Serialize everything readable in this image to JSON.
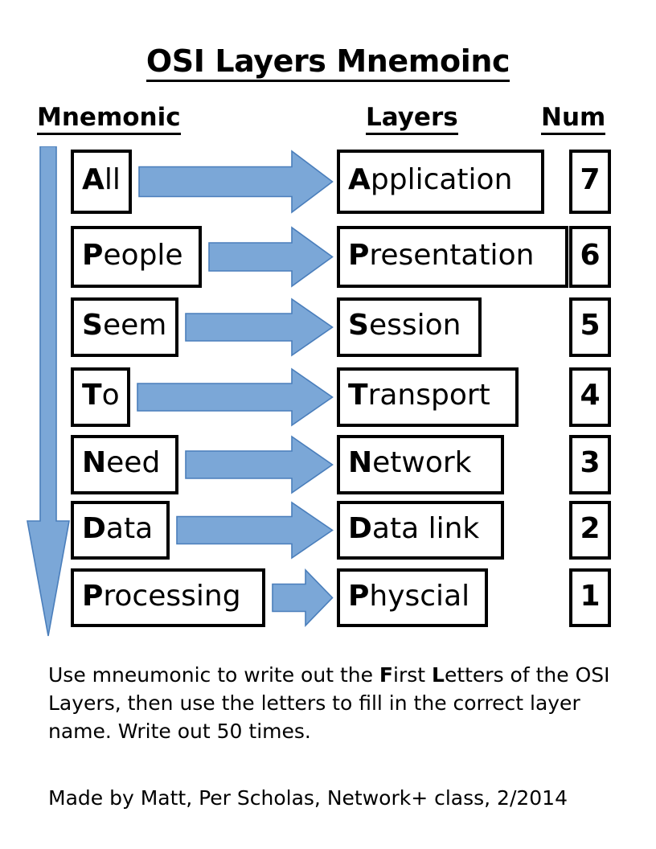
{
  "title": "OSI Layers Mnemoinc",
  "headers": {
    "mnemonic": "Mnemonic",
    "layers": "Layers",
    "num": "Num"
  },
  "colors": {
    "arrow_fill": "#7BA7D7",
    "arrow_stroke": "#4A7EBB",
    "box_border": "#000000",
    "text": "#000000",
    "background": "#FFFFFF"
  },
  "icons": {
    "down_arrow": "down-arrow-icon",
    "right_arrow": "right-arrow-icon"
  },
  "rows": [
    {
      "mnemonic_initial": "A",
      "mnemonic_rest": "ll",
      "mnemonic": "All",
      "layer_initial": "A",
      "layer_rest": "pplication",
      "layer": "Application",
      "num": "7"
    },
    {
      "mnemonic_initial": "P",
      "mnemonic_rest": "eople",
      "mnemonic": "People",
      "layer_initial": "P",
      "layer_rest": "resentation",
      "layer": "Presentation",
      "num": "6"
    },
    {
      "mnemonic_initial": "S",
      "mnemonic_rest": "eem",
      "mnemonic": "Seem",
      "layer_initial": "S",
      "layer_rest": "ession",
      "layer": "Session",
      "num": "5"
    },
    {
      "mnemonic_initial": "T",
      "mnemonic_rest": "o",
      "mnemonic": "To",
      "layer_initial": "T",
      "layer_rest": "ransport",
      "layer": "Transport",
      "num": "4"
    },
    {
      "mnemonic_initial": "N",
      "mnemonic_rest": "eed",
      "mnemonic": "Need",
      "layer_initial": "N",
      "layer_rest": "etwork",
      "layer": "Network",
      "num": "3"
    },
    {
      "mnemonic_initial": "D",
      "mnemonic_rest": "ata",
      "mnemonic": "Data",
      "layer_initial": "D",
      "layer_rest": "ata link",
      "layer": "Data link",
      "num": "2"
    },
    {
      "mnemonic_initial": "P",
      "mnemonic_rest": "rocessing",
      "mnemonic": "Processing",
      "layer_initial": "P",
      "layer_rest": "hyscial",
      "layer": "Physcial",
      "num": "1"
    }
  ],
  "note": {
    "part1": "Use mneumonic to write out the ",
    "bold1": "F",
    "part2": "irst ",
    "bold2": "L",
    "part3": "etters of the OSI Layers, then use the letters to fill in the correct layer name.  Write out 50 times."
  },
  "credit": "Made by Matt, Per Scholas, Network+ class, 2/2014"
}
